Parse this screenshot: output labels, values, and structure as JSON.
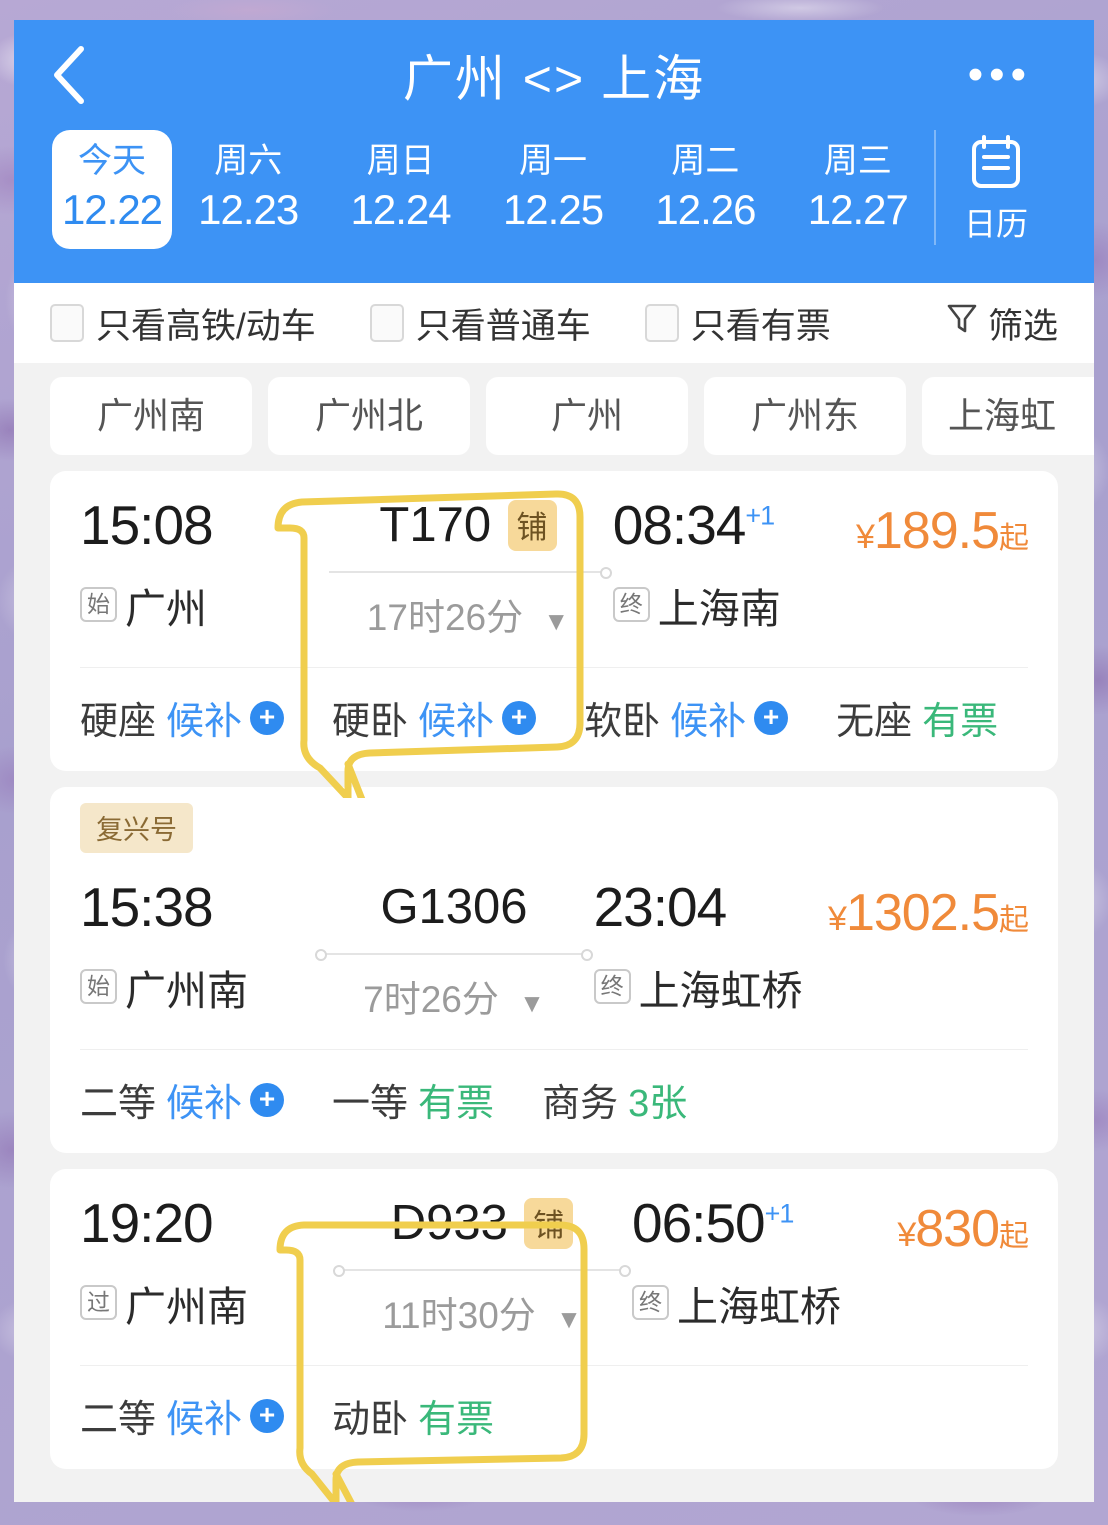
{
  "header": {
    "title": "广州 <> 上海",
    "back_icon": "chevron-left-icon",
    "more_icon": "ellipsis-icon",
    "accent_blue": "#3d93f5"
  },
  "dates": [
    {
      "weekday": "今天",
      "date": "12.22",
      "active": true
    },
    {
      "weekday": "周六",
      "date": "12.23",
      "active": false
    },
    {
      "weekday": "周日",
      "date": "12.24",
      "active": false
    },
    {
      "weekday": "周一",
      "date": "12.25",
      "active": false
    },
    {
      "weekday": "周二",
      "date": "12.26",
      "active": false
    },
    {
      "weekday": "周三",
      "date": "12.27",
      "active": false
    }
  ],
  "calendar": {
    "label": "日历",
    "icon": "calendar-icon"
  },
  "filters": {
    "options": [
      {
        "label": "只看高铁/动车",
        "checked": false
      },
      {
        "label": "只看普通车",
        "checked": false
      },
      {
        "label": "只看有票",
        "checked": false
      }
    ],
    "filter_button": {
      "label": "筛选",
      "icon": "funnel-icon"
    }
  },
  "stations": [
    {
      "label": "广州南"
    },
    {
      "label": "广州北"
    },
    {
      "label": "广州"
    },
    {
      "label": "广州东"
    },
    {
      "label": "上海虹"
    }
  ],
  "trains": [
    {
      "tag": null,
      "depart_time": "15:08",
      "depart_mark": "始",
      "depart_station": "广州",
      "train_no": "T170",
      "train_badge": "铺",
      "duration": "17时26分",
      "arrive_time": "08:34",
      "arrive_next_day": "+1",
      "arrive_mark": "终",
      "arrive_station": "上海南",
      "price_currency": "¥",
      "price": "189.5",
      "price_suffix": "起",
      "seats": [
        {
          "name": "硬座",
          "status": "候补",
          "status_type": "waitlist",
          "has_plus": true
        },
        {
          "name": "硬卧",
          "status": "候补",
          "status_type": "waitlist",
          "has_plus": true
        },
        {
          "name": "软卧",
          "status": "候补",
          "status_type": "waitlist",
          "has_plus": true
        },
        {
          "name": "无座",
          "status": "有票",
          "status_type": "available",
          "has_plus": false
        }
      ]
    },
    {
      "tag": "复兴号",
      "depart_time": "15:38",
      "depart_mark": "始",
      "depart_station": "广州南",
      "train_no": "G1306",
      "train_badge": null,
      "duration": "7时26分",
      "arrive_time": "23:04",
      "arrive_next_day": null,
      "arrive_mark": "终",
      "arrive_station": "上海虹桥",
      "price_currency": "¥",
      "price": "1302.5",
      "price_suffix": "起",
      "seats": [
        {
          "name": "二等",
          "status": "候补",
          "status_type": "waitlist",
          "has_plus": true
        },
        {
          "name": "一等",
          "status": "有票",
          "status_type": "available",
          "has_plus": false
        },
        {
          "name": "商务",
          "status": "3张",
          "status_type": "available",
          "has_plus": false
        }
      ]
    },
    {
      "tag": null,
      "depart_time": "19:20",
      "depart_mark": "过",
      "depart_station": "广州南",
      "train_no": "D933",
      "train_badge": "铺",
      "duration": "11时30分",
      "arrive_time": "06:50",
      "arrive_next_day": "+1",
      "arrive_mark": "终",
      "arrive_station": "上海虹桥",
      "price_currency": "¥",
      "price": "830",
      "price_suffix": "起",
      "seats": [
        {
          "name": "二等",
          "status": "候补",
          "status_type": "waitlist",
          "has_plus": true
        },
        {
          "name": "动卧",
          "status": "有票",
          "status_type": "available",
          "has_plus": false
        }
      ]
    }
  ],
  "annotations": {
    "callout_color": "#f0ce4e",
    "callout_1_target": "硬卧",
    "callout_2_target": "动卧"
  },
  "colors": {
    "price_orange": "#f08a3a",
    "waitlist_blue": "#3d93f5",
    "available_green": "#3ab87a",
    "badge_gold": "#f7d99a",
    "tag_cream": "#f5e7ca"
  }
}
